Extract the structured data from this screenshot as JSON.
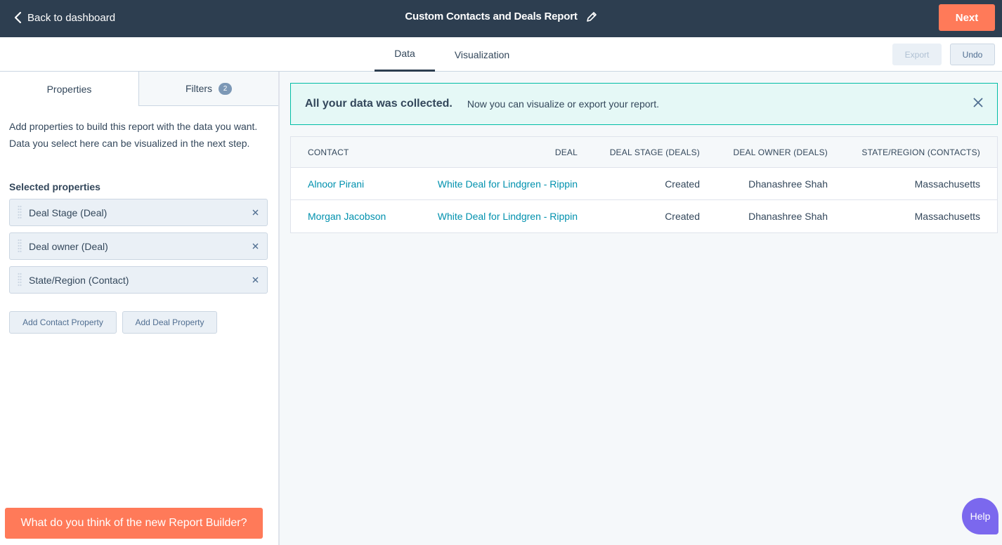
{
  "header": {
    "back_label": "Back to dashboard",
    "report_title": "Custom Contacts and Deals Report",
    "next_label": "Next"
  },
  "tabs": {
    "data_label": "Data",
    "visualization_label": "Visualization",
    "export_label": "Export",
    "undo_label": "Undo"
  },
  "sidebar": {
    "properties_tab": "Properties",
    "filters_tab": "Filters",
    "filters_count": "2",
    "description": "Add properties to build this report with the data you want. Data you select here can be visualized in the next step.",
    "selected_heading": "Selected properties",
    "properties": [
      {
        "label": "Deal Stage (Deal)"
      },
      {
        "label": "Deal owner (Deal)"
      },
      {
        "label": "State/Region (Contact)"
      }
    ],
    "add_contact_label": "Add Contact Property",
    "add_deal_label": "Add Deal Property",
    "feedback_label": "What do you think of the new Report Builder?"
  },
  "alert": {
    "title": "All your data was collected.",
    "message": "Now you can visualize or export your report."
  },
  "table": {
    "columns": [
      "CONTACT",
      "DEAL",
      "DEAL STAGE (DEALS)",
      "DEAL OWNER (DEALS)",
      "STATE/REGION (CONTACTS)"
    ],
    "rows": [
      {
        "contact": "Alnoor Pirani",
        "deal": "White Deal for Lindgren - Rippin",
        "stage": "Created",
        "owner": "Dhanashree Shah",
        "state": "Massachusetts"
      },
      {
        "contact": "Morgan Jacobson",
        "deal": "White Deal for Lindgren - Rippin",
        "stage": "Created",
        "owner": "Dhanashree Shah",
        "state": "Massachusetts"
      }
    ]
  },
  "help_label": "Help",
  "colors": {
    "topbar": "#2d3e50",
    "accent_orange": "#ff7a59",
    "link": "#0091ae",
    "alert_bg": "#e5f8f6",
    "alert_border": "#00bda5",
    "help": "#7b68ee"
  }
}
